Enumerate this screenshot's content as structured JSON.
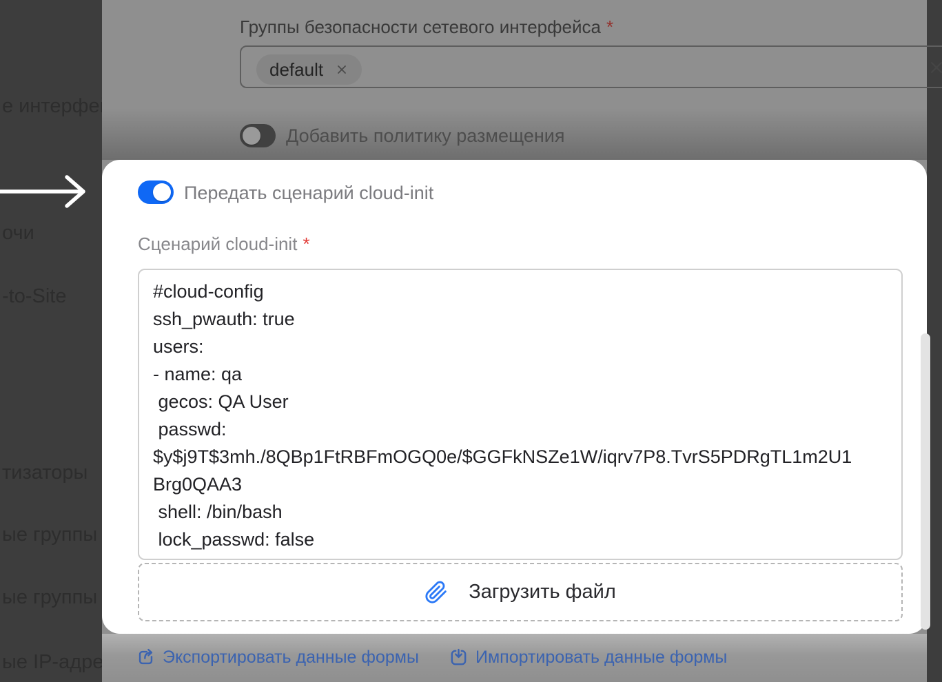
{
  "colors": {
    "accent_blue": "#0f68f5",
    "link_blue_dimmed": "#3b63b0",
    "required_red": "#e23a36",
    "paperclip_blue": "#2b79f7",
    "spotlight_bg": "#ffffff",
    "dim_overlay": "#8f8f8f",
    "backdrop_dark": "#3d3d3d"
  },
  "sidebar": {
    "items": [
      "е интерфей",
      "очи",
      "-to-Site",
      "тизаторы",
      "ые группы",
      "ые группы",
      "ые IP-адре"
    ]
  },
  "form_top": {
    "security_groups": {
      "label": "Группы безопасности сетевого интерфейса",
      "required": "*",
      "selected_tag": "default"
    },
    "placement_toggle": {
      "label": "Добавить политику размещения",
      "state": "off"
    }
  },
  "highlight_panel": {
    "cloud_init_toggle": {
      "label": "Передать сценарий cloud-init",
      "state": "on"
    },
    "cloud_init_field": {
      "label": "Сценарий cloud-init",
      "required": "*",
      "value": "#cloud-config\nssh_pwauth: true\nusers:\n- name: qa\n gecos: QA User\n passwd:\n$y$j9T$3mh./8QBp1FtRBFmOGQ0e/$GGFkNSZe1W/iqrv7P8.TvrS5PDRgTL1m2U1\nBrg0QAA3\n shell: /bin/bash\n lock_passwd: false"
    },
    "upload_button": {
      "label": "Загрузить файл"
    }
  },
  "footer": {
    "export_label": "Экспортировать данные формы",
    "import_label": "Импортировать данные формы"
  },
  "icons": {
    "chip_remove": "x-cross",
    "clear_select": "x-cross",
    "chevron_down": "v-chevron",
    "paperclip": "paperclip",
    "export": "box-arrow-out",
    "import": "box-arrow-in",
    "annotation_arrow": "white-right-arrow"
  }
}
